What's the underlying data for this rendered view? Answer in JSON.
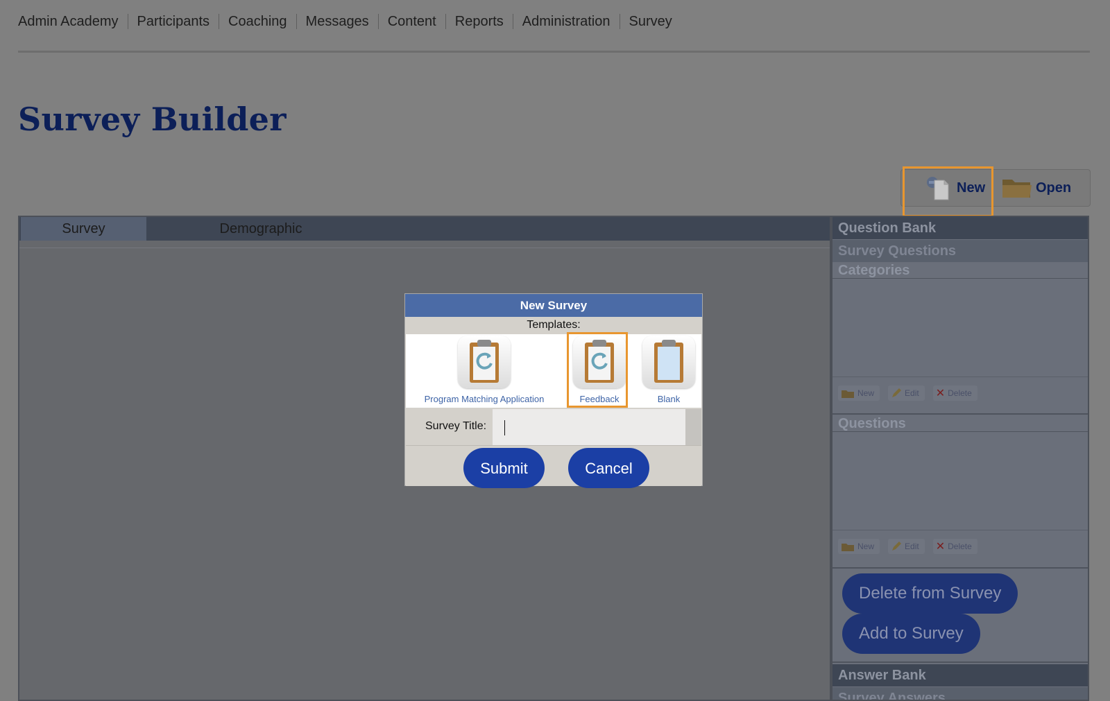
{
  "nav": {
    "items": [
      {
        "label": "Admin Academy"
      },
      {
        "label": "Participants"
      },
      {
        "label": "Coaching"
      },
      {
        "label": "Messages"
      },
      {
        "label": "Content"
      },
      {
        "label": "Reports"
      },
      {
        "label": "Administration"
      },
      {
        "label": "Survey"
      }
    ]
  },
  "page": {
    "title": "Survey Builder"
  },
  "toolbar": {
    "new_label": "New",
    "open_label": "Open"
  },
  "tabs": [
    {
      "label": "Survey",
      "active": true
    },
    {
      "label": "Demographic",
      "active": false
    }
  ],
  "sidebar": {
    "question_bank": "Question Bank",
    "survey_questions": "Survey Questions",
    "categories": "Categories",
    "questions": "Questions",
    "mini_new": "New",
    "mini_edit": "Edit",
    "mini_delete": "Delete",
    "delete_from_survey": "Delete from Survey",
    "add_to_survey": "Add to Survey",
    "answer_bank": "Answer Bank",
    "survey_answers": "Survey Answers"
  },
  "modal": {
    "title": "New Survey",
    "templates_label": "Templates:",
    "templates": [
      {
        "label": "Program Matching Application",
        "icon": "clipboard-refresh-icon"
      },
      {
        "label": "Feedback",
        "icon": "clipboard-refresh-icon",
        "selected": true
      },
      {
        "label": "Blank",
        "icon": "clipboard-blank-icon"
      }
    ],
    "survey_title_label": "Survey Title:",
    "survey_title_value": "",
    "submit_label": "Submit",
    "cancel_label": "Cancel"
  },
  "colors": {
    "brand_navy": "#0c1f58",
    "button_blue": "#1b3fa5",
    "modal_header": "#4b6ba6",
    "highlight": "#e8962f"
  }
}
